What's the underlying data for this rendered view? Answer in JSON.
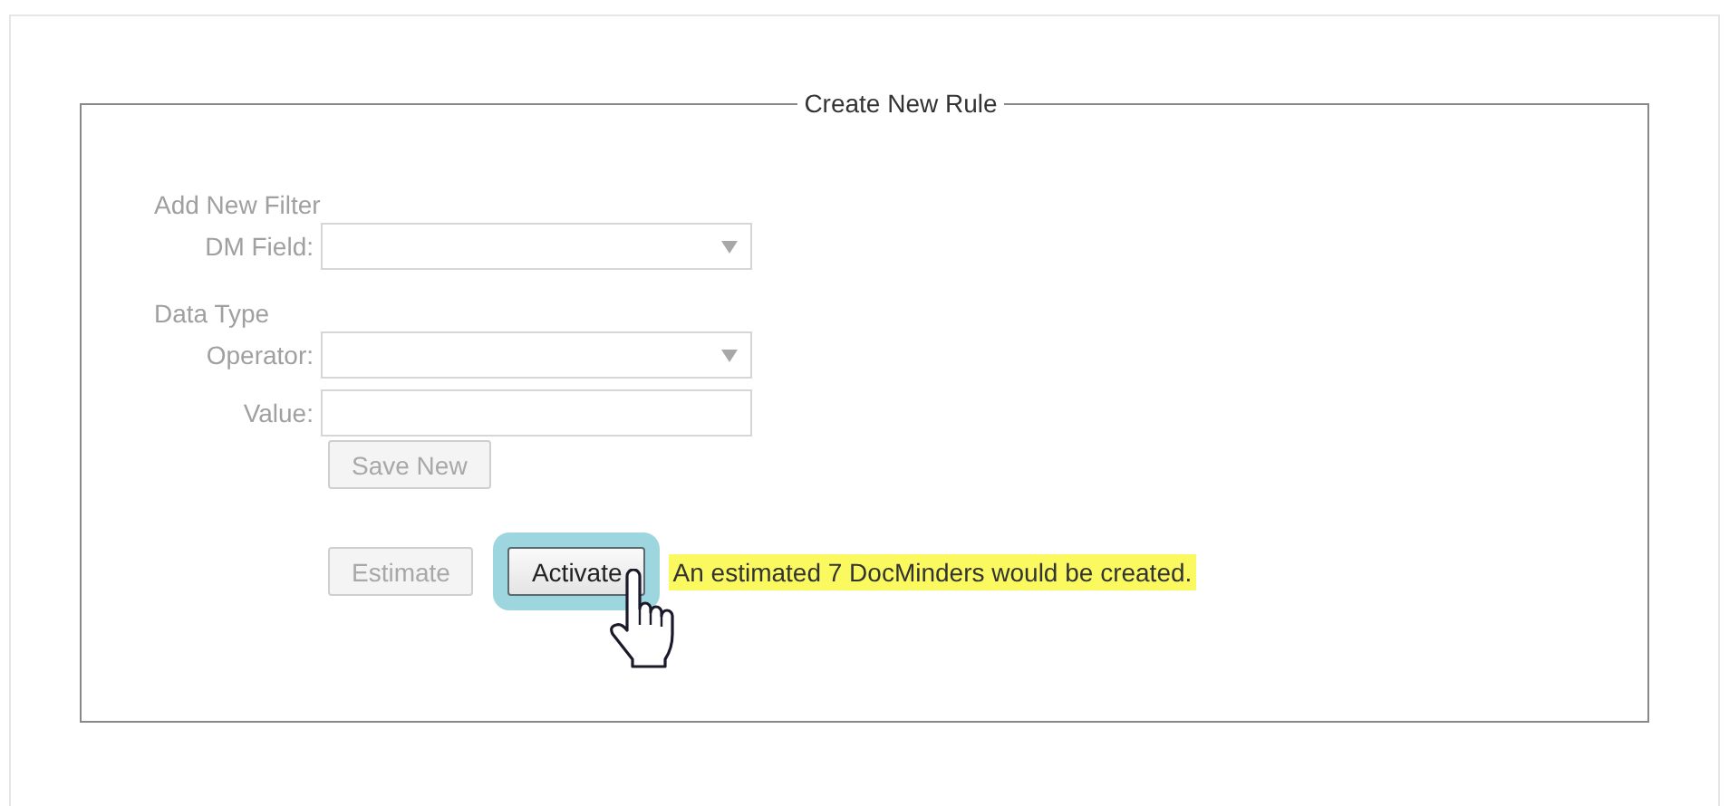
{
  "panel": {
    "legend": "Create New Rule"
  },
  "groups": [
    {
      "heading": "Add New Filter",
      "fields": [
        {
          "label": "DM Field:",
          "kind": "select",
          "disabled": true
        }
      ]
    },
    {
      "heading": "Data Type",
      "fields": [
        {
          "label": "Operator:",
          "kind": "select",
          "disabled": true
        },
        {
          "label": "Value:",
          "kind": "text",
          "disabled": true
        }
      ]
    }
  ],
  "save_button": {
    "label": "Save New",
    "disabled": true
  },
  "actions": [
    {
      "label": "Estimate",
      "disabled": true,
      "focused": false
    },
    {
      "label": "Activate",
      "disabled": false,
      "focused": true
    }
  ],
  "message": {
    "text": "An estimated 7 DocMinders would be created.",
    "highlighted": true
  }
}
